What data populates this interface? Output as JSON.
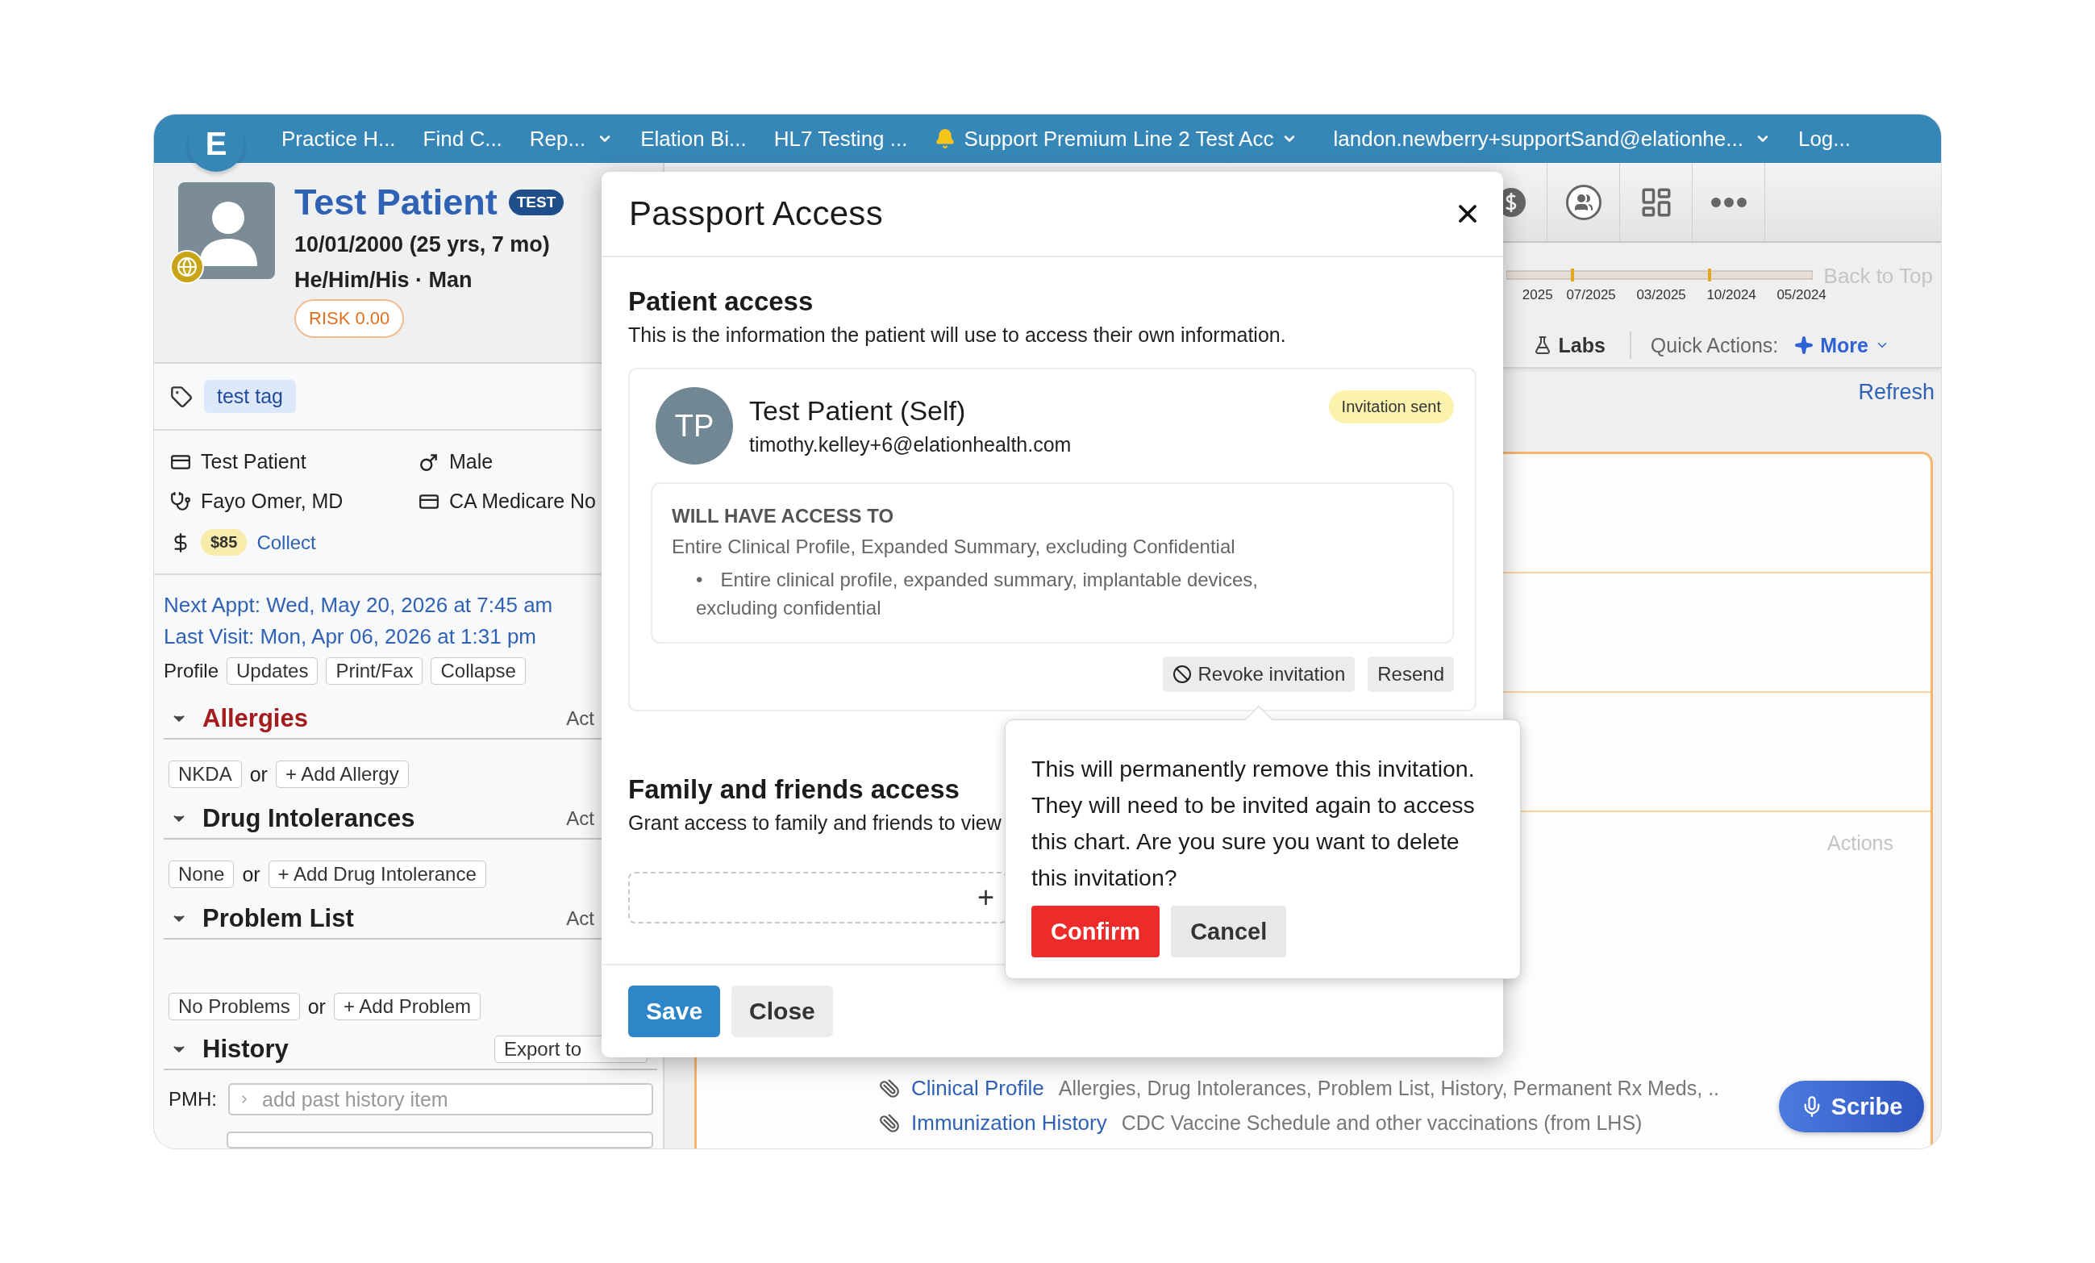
{
  "top_bar": {
    "logo": "E",
    "nav": [
      {
        "label": "Practice H...",
        "has_menu": false,
        "bell": false
      },
      {
        "label": "Find C...",
        "has_menu": false,
        "bell": false
      },
      {
        "label": "Rep...",
        "has_menu": true,
        "bell": false
      },
      {
        "label": "Elation Bi...",
        "has_menu": false,
        "bell": false
      },
      {
        "label": "HL7 Testing ...",
        "has_menu": false,
        "bell": false
      },
      {
        "label": "Support Premium Line 2 Test Acc",
        "has_menu": true,
        "bell": true
      },
      {
        "label": "landon.newberry+supportSand@elationhe...",
        "has_menu": true,
        "bell": false
      },
      {
        "label": "Log...",
        "has_menu": false,
        "bell": false
      }
    ]
  },
  "patient": {
    "name": "Test Patient",
    "badge": "TEST",
    "dob": "10/01/2000 (25 yrs, 7 mo)",
    "identity": "He/Him/His · Man",
    "risk": "RISK 0.00",
    "tags": [
      "test tag"
    ],
    "details": [
      {
        "kind": "id",
        "text": "Test Patient"
      },
      {
        "kind": "sex",
        "text": "Male"
      },
      {
        "kind": "provider",
        "text": "Fayo Omer, MD"
      },
      {
        "kind": "insurance",
        "text": "CA Medicare No"
      }
    ],
    "balance": {
      "amount": "$85",
      "action": "Collect"
    },
    "next_appt": "Next Appt: Wed, May 20, 2026 at 7:45 am",
    "last_visit": "Last Visit: Mon, Apr 06, 2026 at 1:31 pm",
    "profile": {
      "label": "Profile",
      "buttons": [
        "Updates",
        "Print/Fax",
        "Collapse"
      ]
    }
  },
  "sections": [
    {
      "kind": "list",
      "title": "Allergies",
      "alert": true,
      "action": "Act",
      "chips": [
        "NKDA",
        "+ Add Allergy"
      ],
      "joiner": "or"
    },
    {
      "kind": "list",
      "title": "Drug Intolerances",
      "alert": false,
      "action": "Act",
      "chips": [
        "None",
        "+ Add Drug Intolerance"
      ],
      "joiner": "or"
    },
    {
      "kind": "list",
      "title": "Problem List",
      "alert": false,
      "action": "Act",
      "chips": [
        "No Problems",
        "+ Add Problem"
      ],
      "joiner": "or"
    },
    {
      "kind": "history",
      "title": "History",
      "alert": false,
      "action": "Export to",
      "field_label": "PMH:",
      "placeholder": "add past history item"
    }
  ],
  "timeline": {
    "ticks": [
      "2025",
      "07/2025",
      "03/2025",
      "10/2024",
      "05/2024"
    ],
    "back_to_top": "Back to Top"
  },
  "quick_bar": {
    "labs": "Labs",
    "label": "Quick Actions:",
    "more": "More"
  },
  "refresh": "Refresh",
  "card": {
    "actions": "Actions",
    "documents": [
      {
        "title": "Clinical Profile",
        "description": "Allergies, Drug Intolerances, Problem List, History, Permanent Rx Meds, .."
      },
      {
        "title": "Immunization History",
        "description": "CDC Vaccine Schedule and other vaccinations (from LHS)"
      }
    ]
  },
  "scribe": "Scribe",
  "modal": {
    "title": "Passport Access",
    "patient_section": {
      "title": "Patient access",
      "description": "This is the information the patient will use to access their own information.",
      "person": {
        "initials": "TP",
        "name": "Test Patient (Self)",
        "email": "timothy.kelley+6@elationhealth.com",
        "status": "Invitation sent"
      },
      "access": {
        "heading": "WILL HAVE ACCESS TO",
        "summary": "Entire Clinical Profile, Expanded Summary, excluding Confidential",
        "items": [
          {
            "bullet": "•",
            "text": "Entire clinical profile, expanded summary, implantable devices, excluding confidential"
          }
        ]
      },
      "actions": [
        "Revoke invitation",
        "Resend"
      ]
    },
    "family_section": {
      "title": "Family and friends access",
      "description": "Grant access to family and friends to view",
      "add": "+"
    },
    "buttons": [
      "Save",
      "Close"
    ]
  },
  "confirm_popover": {
    "message": "This will permanently remove this invitation. They will need to be invited again to access this chart. Are you sure you want to delete this invitation?",
    "buttons": [
      "Confirm",
      "Cancel"
    ]
  }
}
